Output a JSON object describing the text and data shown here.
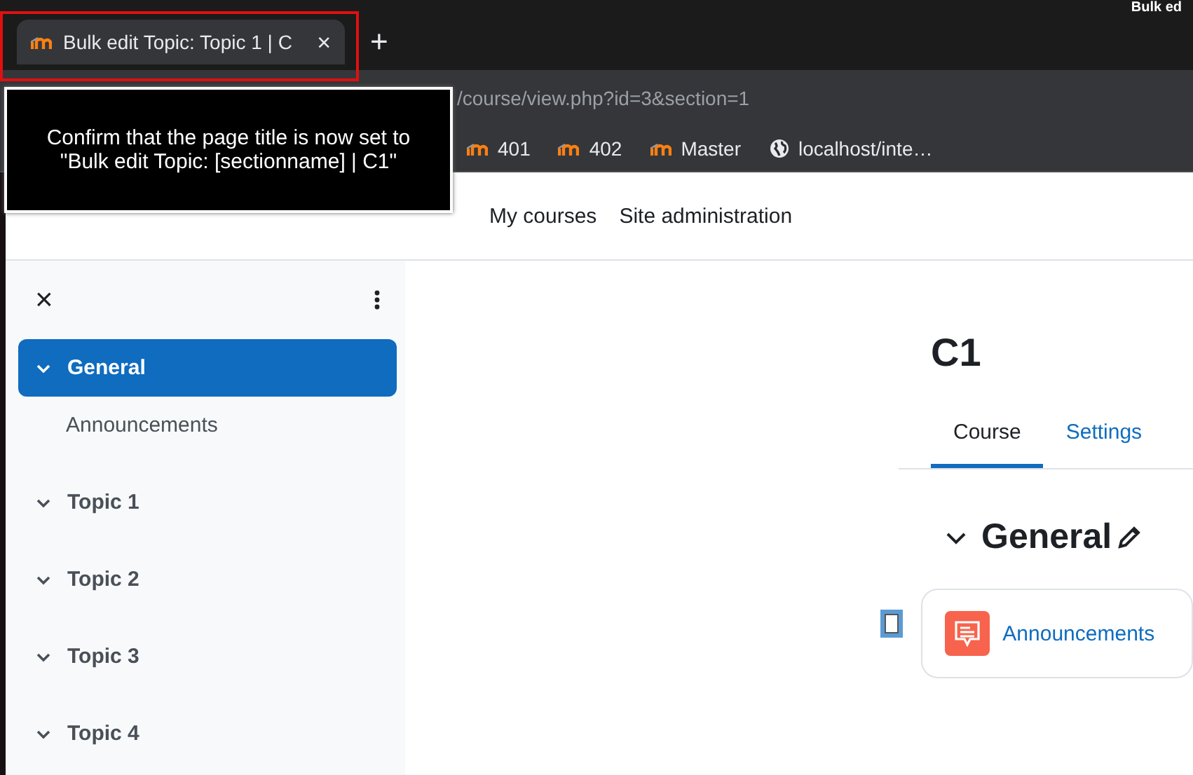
{
  "window": {
    "title": "Bulk ed"
  },
  "browser_tab": {
    "title": "Bulk edit Topic: Topic 1 | C",
    "selected": true,
    "close": "×",
    "new_tab": "+"
  },
  "address_bar": {
    "url": "/course/view.php?id=3&section=1"
  },
  "bookmarks": [
    {
      "label": "401",
      "kind": "moodle"
    },
    {
      "label": "402",
      "kind": "moodle"
    },
    {
      "label": "Master",
      "kind": "moodle"
    },
    {
      "label": "localhost/inte…",
      "kind": "globe"
    }
  ],
  "tooltip": {
    "text": "Confirm that the page title is now set to \"Bulk edit Topic: [sectionname] | C1\""
  },
  "navbar": {
    "links": [
      "My courses",
      "Site administration"
    ]
  },
  "course_index": {
    "close": "×",
    "items": [
      {
        "label": "General",
        "selected": true,
        "children": [
          {
            "label": "Announcements"
          }
        ]
      },
      {
        "label": "Topic 1",
        "selected": false
      },
      {
        "label": "Topic 2",
        "selected": false
      },
      {
        "label": "Topic 3",
        "selected": false
      },
      {
        "label": "Topic 4",
        "selected": false
      }
    ]
  },
  "course": {
    "title": "C1",
    "tabs": [
      {
        "label": "Course",
        "selected": true
      },
      {
        "label": "Settings",
        "selected": false
      }
    ],
    "section": {
      "title": "General",
      "activities": [
        {
          "name": "Announcements",
          "checked": false
        }
      ]
    }
  }
}
